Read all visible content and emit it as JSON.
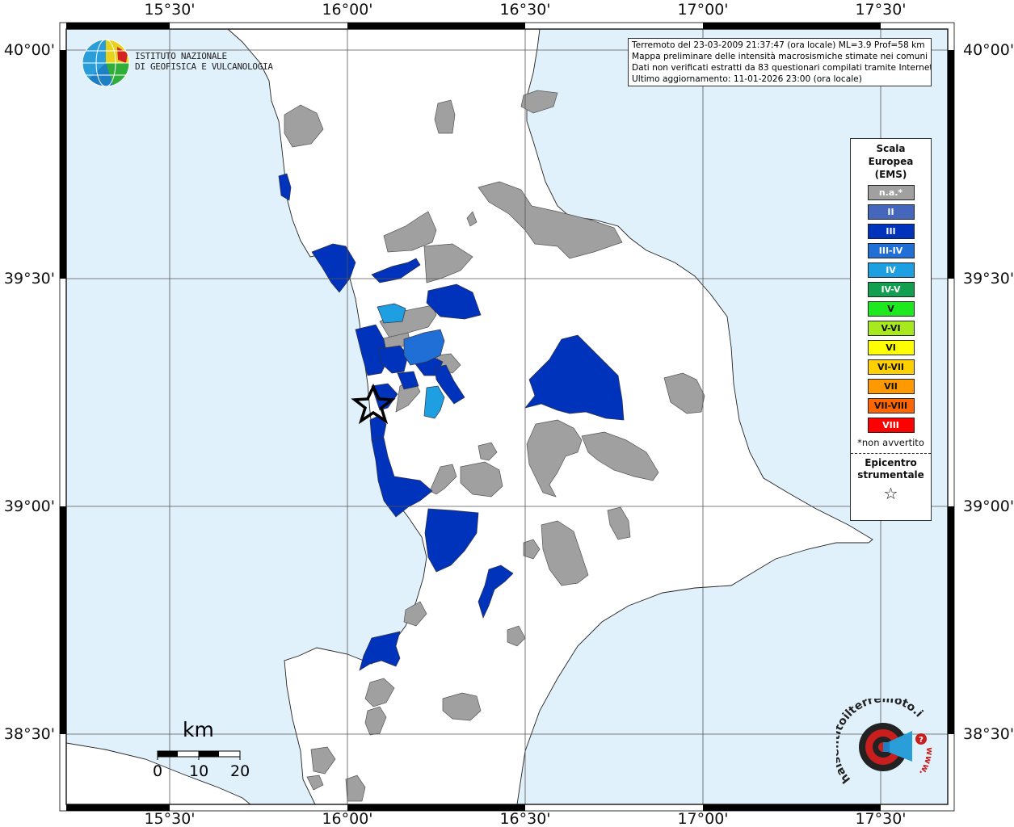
{
  "map": {
    "longitude_labels": [
      "15°30'",
      "16°00'",
      "16°30'",
      "17°00'",
      "17°30'"
    ],
    "latitude_labels": [
      "40°00'",
      "39°30'",
      "39°00'",
      "38°30'"
    ],
    "colors": {
      "sea": "#e1f1fb",
      "land": "#ffffff",
      "not_felt": "#a0a0a0",
      "III": "#0033bb",
      "III-IV": "#1f6fd6",
      "IV": "#1e9fe2"
    },
    "epicenter_icon": "star-icon"
  },
  "institute": {
    "line1": "ISTITUTO NAZIONALE",
    "line2": "DI GEOFISICA E VULCANOLOGIA",
    "logo_icon": "globe-icon"
  },
  "info": {
    "line1": "Terremoto del 23-03-2009 21:37:47 (ora locale) ML=3.9 Prof=58 km",
    "line2": "Mappa preliminare delle intensità macrosismiche stimate nei comuni",
    "line3": "Dati non verificati estratti da 83 questionari compilati tramite Internet.",
    "line4": "Ultimo aggiornamento: 11-01-2026 23:00 (ora locale)"
  },
  "legend": {
    "title": [
      "Scala",
      "Europea",
      "(EMS)"
    ],
    "items": [
      {
        "label": "n.a.*",
        "color": "#a0a0a0"
      },
      {
        "label": "II",
        "color": "#4466bb"
      },
      {
        "label": "III",
        "color": "#0033bb"
      },
      {
        "label": "III-IV",
        "color": "#1f6fd6"
      },
      {
        "label": "IV",
        "color": "#1e9fe2"
      },
      {
        "label": "IV-V",
        "color": "#12a050"
      },
      {
        "label": "V",
        "color": "#1ee81e"
      },
      {
        "label": "V-VI",
        "color": "#a8e81e"
      },
      {
        "label": "VI",
        "color": "#ffff00"
      },
      {
        "label": "VI-VII",
        "color": "#ffd000"
      },
      {
        "label": "VII",
        "color": "#ff9900"
      },
      {
        "label": "VII-VIII",
        "color": "#ff6600"
      },
      {
        "label": "VIII",
        "color": "#ff0000"
      }
    ],
    "note": "*non avvertito",
    "epicenter_label": [
      "Epicentro",
      "strumentale"
    ],
    "epicenter_symbol": "☆"
  },
  "scale_bar": {
    "unit": "km",
    "labels": [
      "0",
      "10",
      "20"
    ]
  },
  "badge": {
    "text": "haisentitoilterremoto.it",
    "prefix": "www."
  }
}
